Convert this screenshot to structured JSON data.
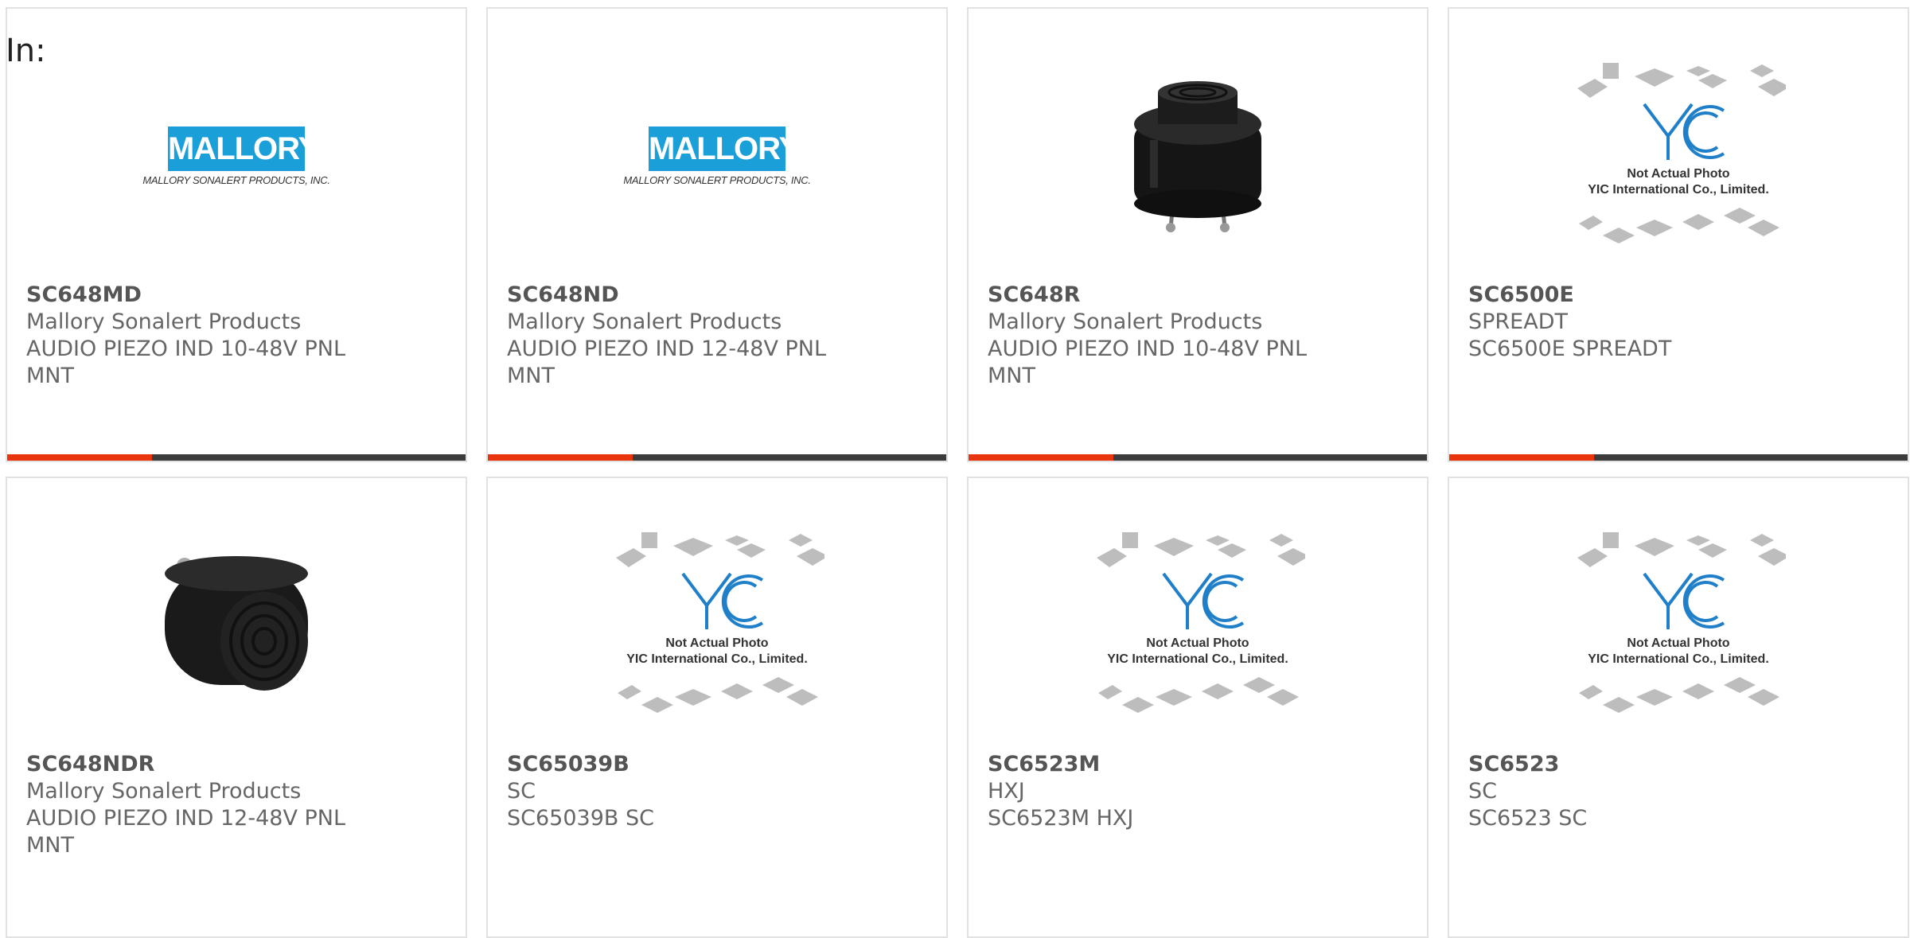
{
  "heading": "In:",
  "colors": {
    "accent": "#e8350e",
    "bar": "#3c3c3c",
    "logo_blue": "#1a9fd8",
    "border": "#e2e2e2"
  },
  "cards": [
    {
      "part": "SC648MD",
      "manufacturer": "Mallory Sonalert Products",
      "desc_lines": [
        "AUDIO PIEZO IND 10-48V PNL",
        "MNT"
      ],
      "image": "mallory-logo",
      "logo_text": "MALLORY",
      "logo_sub": "MALLORY SONALERT PRODUCTS, INC."
    },
    {
      "part": "SC648ND",
      "manufacturer": "Mallory Sonalert Products",
      "desc_lines": [
        "AUDIO PIEZO IND 12-48V PNL",
        "MNT"
      ],
      "image": "mallory-logo",
      "logo_text": "MALLORY",
      "logo_sub": "MALLORY SONALERT PRODUCTS, INC."
    },
    {
      "part": "SC648R",
      "manufacturer": "Mallory Sonalert Products",
      "desc_lines": [
        "AUDIO PIEZO IND 10-48V PNL",
        "MNT"
      ],
      "image": "buzzer-photo-top"
    },
    {
      "part": "SC6500E",
      "manufacturer": "SPREADT",
      "desc_lines": [
        "SC6500E SPREADT"
      ],
      "image": "yic-placeholder",
      "ph_line1": "Not Actual Photo",
      "ph_line2": "YIC International Co., Limited."
    },
    {
      "part": "SC648NDR",
      "manufacturer": "Mallory Sonalert Products",
      "desc_lines": [
        "AUDIO PIEZO IND 12-48V PNL",
        "MNT"
      ],
      "image": "buzzer-photo-side"
    },
    {
      "part": "SC65039B",
      "manufacturer": "SC",
      "desc_lines": [
        "SC65039B SC"
      ],
      "image": "yic-placeholder",
      "ph_line1": "Not Actual Photo",
      "ph_line2": "YIC International Co., Limited."
    },
    {
      "part": "SC6523M",
      "manufacturer": "HXJ",
      "desc_lines": [
        "SC6523M HXJ"
      ],
      "image": "yic-placeholder",
      "ph_line1": "Not Actual Photo",
      "ph_line2": "YIC International Co., Limited."
    },
    {
      "part": "SC6523",
      "manufacturer": "SC",
      "desc_lines": [
        "SC6523 SC"
      ],
      "image": "yic-placeholder",
      "ph_line1": "Not Actual Photo",
      "ph_line2": "YIC International Co., Limited."
    }
  ]
}
